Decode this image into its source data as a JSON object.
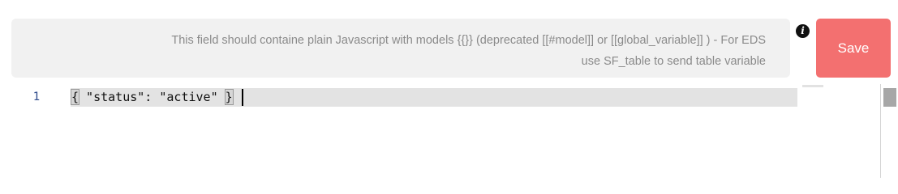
{
  "info": {
    "line1": "This field should containe plain Javascript with models {{}} (deprecated [[#model]] or [[global_variable]] ) - For EDS",
    "line2": "use SF_table to send table variable",
    "icon": "info-icon"
  },
  "toolbar": {
    "save_label": "Save"
  },
  "editor": {
    "lines": [
      {
        "number": "1",
        "open": "{",
        "body": " \"status\": \"active\" ",
        "close": "}"
      }
    ]
  },
  "colors": {
    "save_button": "#f37070",
    "info_box": "#f1f1f1",
    "line_highlight": "#e3e3e3"
  }
}
